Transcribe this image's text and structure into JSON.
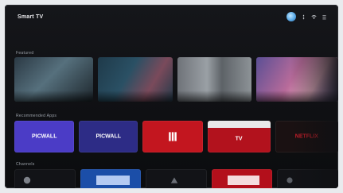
{
  "app": {
    "brand": "Smart TV"
  },
  "sections": [
    {
      "title": "Featured"
    },
    {
      "title": "Recommended Apps"
    },
    {
      "title": "Channels"
    }
  ],
  "featured": [
    {
      "caption": ""
    },
    {
      "caption": ""
    },
    {
      "caption": ""
    },
    {
      "caption": ""
    }
  ],
  "apps": [
    {
      "name": "PICWALL",
      "bg": "#4b3cc6",
      "fg": "#ffffff"
    },
    {
      "name": "PICWALL",
      "bg": "#2d2c86",
      "fg": "#ffffff"
    },
    {
      "name": "",
      "bg": "#c3161f",
      "fg": "#ffffff"
    },
    {
      "name": "TV",
      "bg": "#b2121d",
      "fg": "#ffffff"
    },
    {
      "name": "NETFLIX",
      "bg": "#1a1112",
      "fg": "#d71f2b"
    }
  ],
  "colors": {
    "accent": "#5aa9e6"
  }
}
